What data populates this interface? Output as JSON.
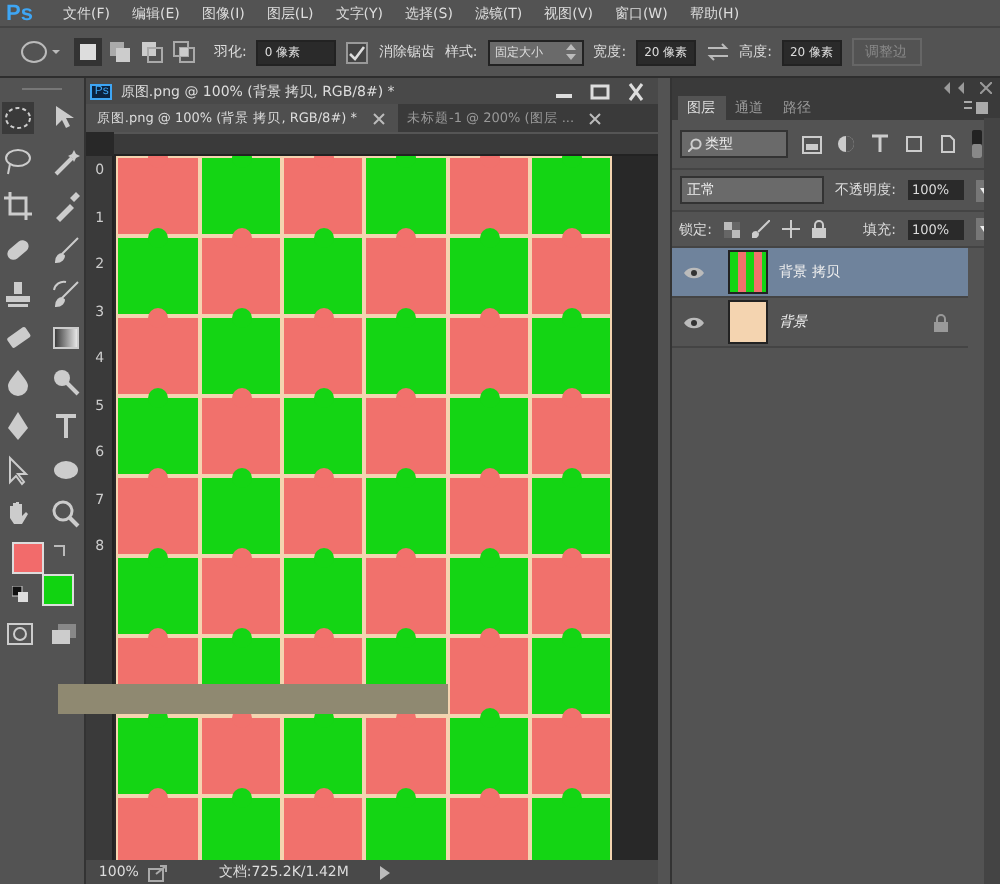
{
  "app": {
    "logo": "Ps",
    "document_icon": "Ps"
  },
  "menu": [
    "文件(F)",
    "编辑(E)",
    "图像(I)",
    "图层(L)",
    "文字(Y)",
    "选择(S)",
    "滤镜(T)",
    "视图(V)",
    "窗口(W)",
    "帮助(H)"
  ],
  "options": {
    "feather_label": "羽化:",
    "feather_value": "0 像素",
    "antialias": {
      "label": "消除锯齿",
      "checked": true
    },
    "style_label": "样式:",
    "style_value": "固定大小",
    "width_label": "宽度:",
    "width_value": "20 像素",
    "height_label": "高度:",
    "height_value": "20 像素",
    "refine": "调整边"
  },
  "document": {
    "title": "原图.png @ 100% (背景 拷贝, RGB/8#) *",
    "tabs": [
      {
        "label": "原图.png @ 100% (背景 拷贝, RGB/8#) *",
        "selected": true
      },
      {
        "label": "未标题-1 @ 200% (图层 ...",
        "selected": false
      }
    ],
    "ruler": [
      "0",
      "1",
      "2",
      "3",
      "4",
      "5",
      "6",
      "7",
      "8"
    ],
    "zoom": "100%",
    "doc_info": "文档:725.2K/1.42M"
  },
  "layers_panel": {
    "tabs": [
      {
        "label": "图层",
        "selected": true
      },
      {
        "label": "通道",
        "selected": false
      },
      {
        "label": "路径",
        "selected": false
      }
    ],
    "filter": "类型",
    "blend_mode": "正常",
    "opacity_label": "不透明度:",
    "opacity": "100%",
    "lock_label": "锁定:",
    "fill_label": "填充:",
    "fill": "100%",
    "layers": [
      {
        "name": "背景 拷贝",
        "selected": true,
        "visible": true,
        "locked": false,
        "kind": "pattern"
      },
      {
        "name": "背景",
        "selected": false,
        "visible": true,
        "locked": true,
        "kind": "photo"
      }
    ]
  }
}
